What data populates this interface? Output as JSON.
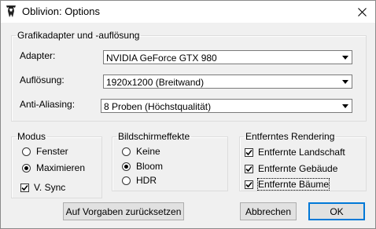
{
  "window": {
    "title": "Oblivion: Options",
    "close_icon": "close-icon",
    "app_icon": "oblivion-emblem-icon"
  },
  "display_group": {
    "legend": "Grafikadapter und -auflösung",
    "adapter_label": "Adapter:",
    "adapter_value": "NVIDIA GeForce GTX 980",
    "resolution_label": "Auflösung:",
    "resolution_value": "1920x1200 (Breitwand)",
    "aa_label": "Anti-Aliasing:",
    "aa_value": "8 Proben (Höchstqualität)"
  },
  "mode_group": {
    "legend": "Modus",
    "window_label": "Fenster",
    "maximize_label": "Maximieren",
    "vsync_label": "V. Sync",
    "selected": "Maximieren",
    "vsync_checked": true
  },
  "effects_group": {
    "legend": "Bildschirmeffekte",
    "none_label": "Keine",
    "bloom_label": "Bloom",
    "hdr_label": "HDR",
    "selected": "Bloom"
  },
  "distant_group": {
    "legend": "Entferntes Rendering",
    "landscape_label": "Entfernte Landschaft",
    "buildings_label": "Entfernte Gebäude",
    "trees_label": "Entfernte Bäume",
    "landscape_checked": true,
    "buildings_checked": true,
    "trees_checked": true
  },
  "buttons": {
    "reset": "Auf Vorgaben zurücksetzen",
    "cancel": "Abbrechen",
    "ok": "OK"
  },
  "colors": {
    "accent": "#0078d7",
    "face": "#f0f0f0",
    "titlebar": "#ffffff"
  }
}
